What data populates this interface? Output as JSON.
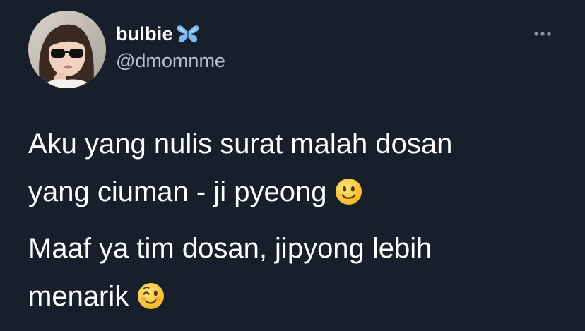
{
  "author": {
    "display_name": "bulbie",
    "handle": "@dmomnme",
    "name_emoji": "butterfly-icon"
  },
  "tweet": {
    "line1": "Aku yang nulis surat malah dosan",
    "line2": "yang ciuman - ji pyeong",
    "line2_emoji": "slightly-smiling-face",
    "line3": "Maaf ya tim dosan, jipyong lebih",
    "line4": "menarik",
    "line4_emoji": "winking-face"
  },
  "colors": {
    "background": "#171f2b",
    "text": "#ffffff",
    "secondary_text": "#b7c0cc",
    "butterfly": "#7fb8f0"
  }
}
